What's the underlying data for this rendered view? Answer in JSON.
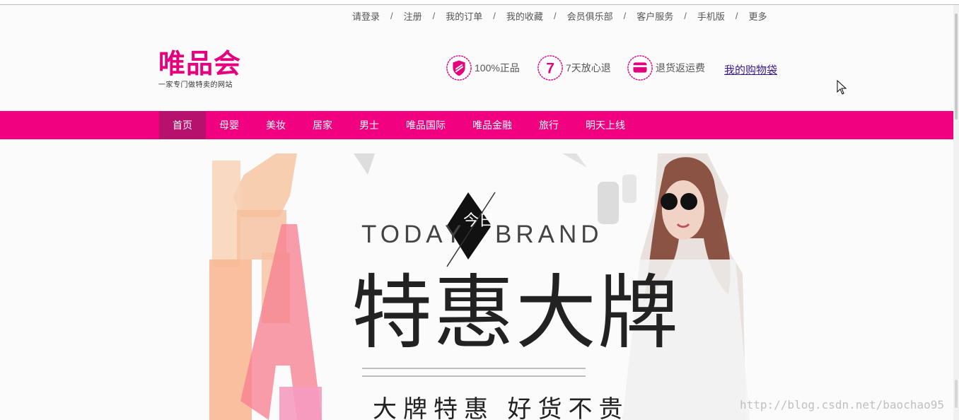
{
  "top_links": [
    "请登录",
    "注册",
    "我的订单",
    "我的收藏",
    "会员俱乐部",
    "客户服务",
    "手机版",
    "更多"
  ],
  "separator": "/",
  "logo": {
    "brand": "唯品会",
    "slogan": "一家专门做特卖的网站"
  },
  "promises": [
    {
      "icon": "shield-icon",
      "text": "100%正品"
    },
    {
      "icon": "seven-days-icon",
      "badge_text": "7",
      "text": "7天放心退"
    },
    {
      "icon": "card-icon",
      "text": "退货返运费"
    }
  ],
  "cart_link": "我的购物袋",
  "nav": {
    "items": [
      "首页",
      "母婴",
      "美妆",
      "居家",
      "男士",
      "唯品国际",
      "唯品金融",
      "旅行",
      "明天上线"
    ],
    "active_index": 0
  },
  "banner": {
    "today": "TODAY",
    "brand": "BRAND",
    "today_cn": "今日",
    "title": "特惠大牌",
    "subtitle": "大牌特惠 好货不贵"
  },
  "watermark": "http://blog.csdn.net/baochao95",
  "colors": {
    "accent": "#f10180",
    "accent_dark": "#b6116c",
    "logo": "#e5007e"
  }
}
